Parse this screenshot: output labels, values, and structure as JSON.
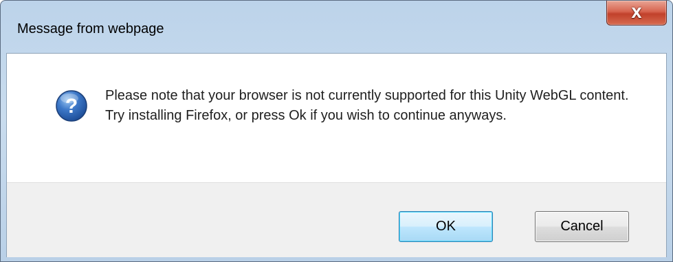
{
  "dialog": {
    "title": "Message from webpage",
    "close_label": "X",
    "message": "Please note that your browser is not currently supported for this Unity WebGL content. Try installing Firefox, or press Ok if you wish to continue anyways.",
    "icon": "question-icon",
    "buttons": {
      "ok_label": "OK",
      "cancel_label": "Cancel"
    }
  },
  "colors": {
    "title_bar": "#c9dcee",
    "close_button": "#c1412b",
    "button_bar": "#f0f0f0",
    "icon_blue": "#2a5ea8"
  }
}
